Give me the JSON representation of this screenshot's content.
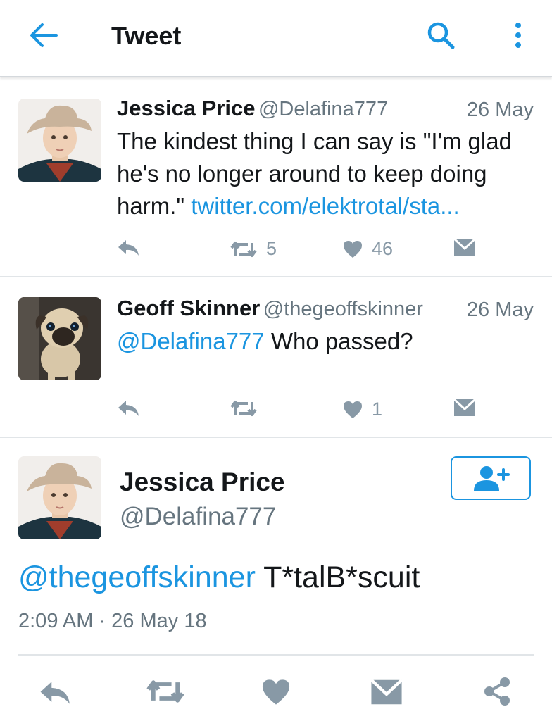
{
  "header": {
    "title": "Tweet"
  },
  "replies": [
    {
      "name": "Jessica Price",
      "handle": "@Delafina777",
      "date": "26 May",
      "text_line1": "The kindest thing I can say is \"I'm glad",
      "text_line2": "he's no longer around to keep doing",
      "text_line3_plain": "harm.\"",
      "text_line3_link": "twitter.com/elektrotal/sta...",
      "retweets": "5",
      "likes": "46"
    },
    {
      "name": "Geoff Skinner",
      "handle": "@thegeoffskinner",
      "date": "26 May",
      "mention": "@Delafina777",
      "text": "Who passed?",
      "retweets": "",
      "likes": "1"
    }
  ],
  "main_tweet": {
    "name": "Jessica Price",
    "handle": "@Delafina777",
    "mention": "@thegeoffskinner",
    "text": "T*talB*scuit",
    "timestamp": "2:09 AM · 26 May 18"
  },
  "colors": {
    "accent": "#1b95e0",
    "icon_gray": "#8899a6",
    "text": "#14171a",
    "secondary": "#66757f"
  },
  "icons": [
    "back-arrow-icon",
    "search-icon",
    "more-vertical-icon",
    "reply-icon",
    "retweet-icon",
    "like-icon",
    "direct-message-icon",
    "share-icon",
    "follow-user-icon"
  ]
}
